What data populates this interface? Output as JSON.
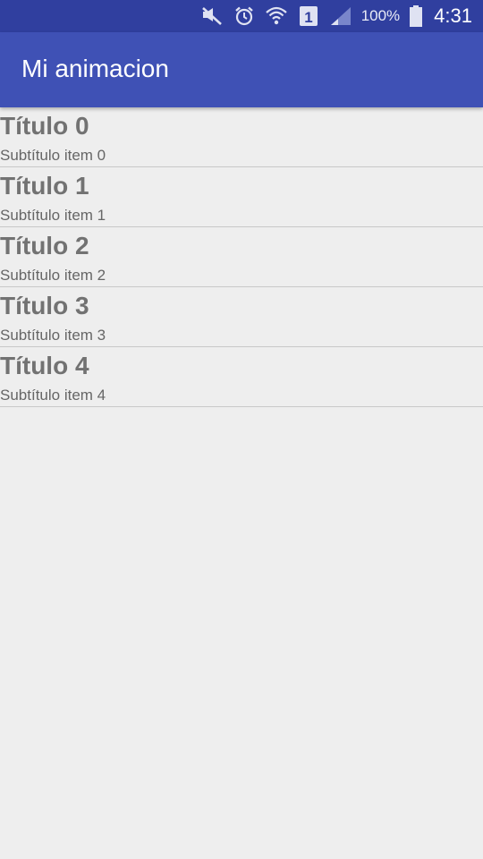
{
  "status_bar": {
    "battery_percent": "100%",
    "time": "4:31",
    "sim_slot": "1",
    "icons": [
      "mute-icon",
      "alarm-icon",
      "wifi-icon",
      "sim-icon",
      "signal-icon",
      "battery-icon"
    ],
    "color": "#303f9f"
  },
  "app_bar": {
    "title": "Mi animacion",
    "color": "#3f51b5"
  },
  "list": {
    "items": [
      {
        "title": "Título 0",
        "subtitle": "Subtítulo item 0"
      },
      {
        "title": "Título 1",
        "subtitle": "Subtítulo item 1"
      },
      {
        "title": "Título 2",
        "subtitle": "Subtítulo item 2"
      },
      {
        "title": "Título 3",
        "subtitle": "Subtítulo item 3"
      },
      {
        "title": "Título 4",
        "subtitle": "Subtítulo item 4"
      }
    ]
  }
}
